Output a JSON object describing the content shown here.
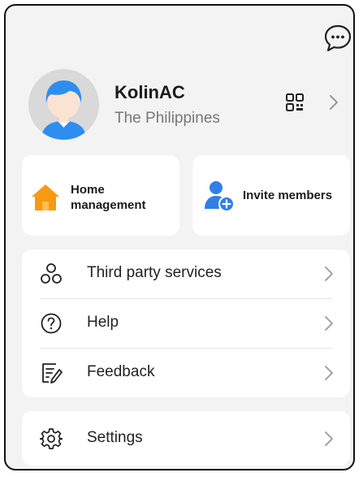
{
  "header": {
    "chat_icon": "chat-bubble-icon"
  },
  "profile": {
    "name": "KolinAC",
    "region": "The Philippines",
    "qr_icon": "qr-code-icon",
    "chevron_icon": "chevron-right-icon"
  },
  "quick_actions": [
    {
      "label": "Home management",
      "icon": "home-icon",
      "icon_color": "#f59a12"
    },
    {
      "label": "Invite members",
      "icon": "add-user-icon",
      "icon_color": "#2f7fe6"
    }
  ],
  "menu": [
    {
      "label": "Third party services",
      "icon": "third-party-icon"
    },
    {
      "label": "Help",
      "icon": "help-icon"
    },
    {
      "label": "Feedback",
      "icon": "feedback-icon"
    }
  ],
  "settings": {
    "label": "Settings",
    "icon": "gear-icon"
  },
  "colors": {
    "background": "#f3f3f4",
    "card": "#ffffff",
    "avatar_blue": "#2d8ef0",
    "text_primary": "#1b1b1b",
    "text_secondary": "#777777"
  }
}
